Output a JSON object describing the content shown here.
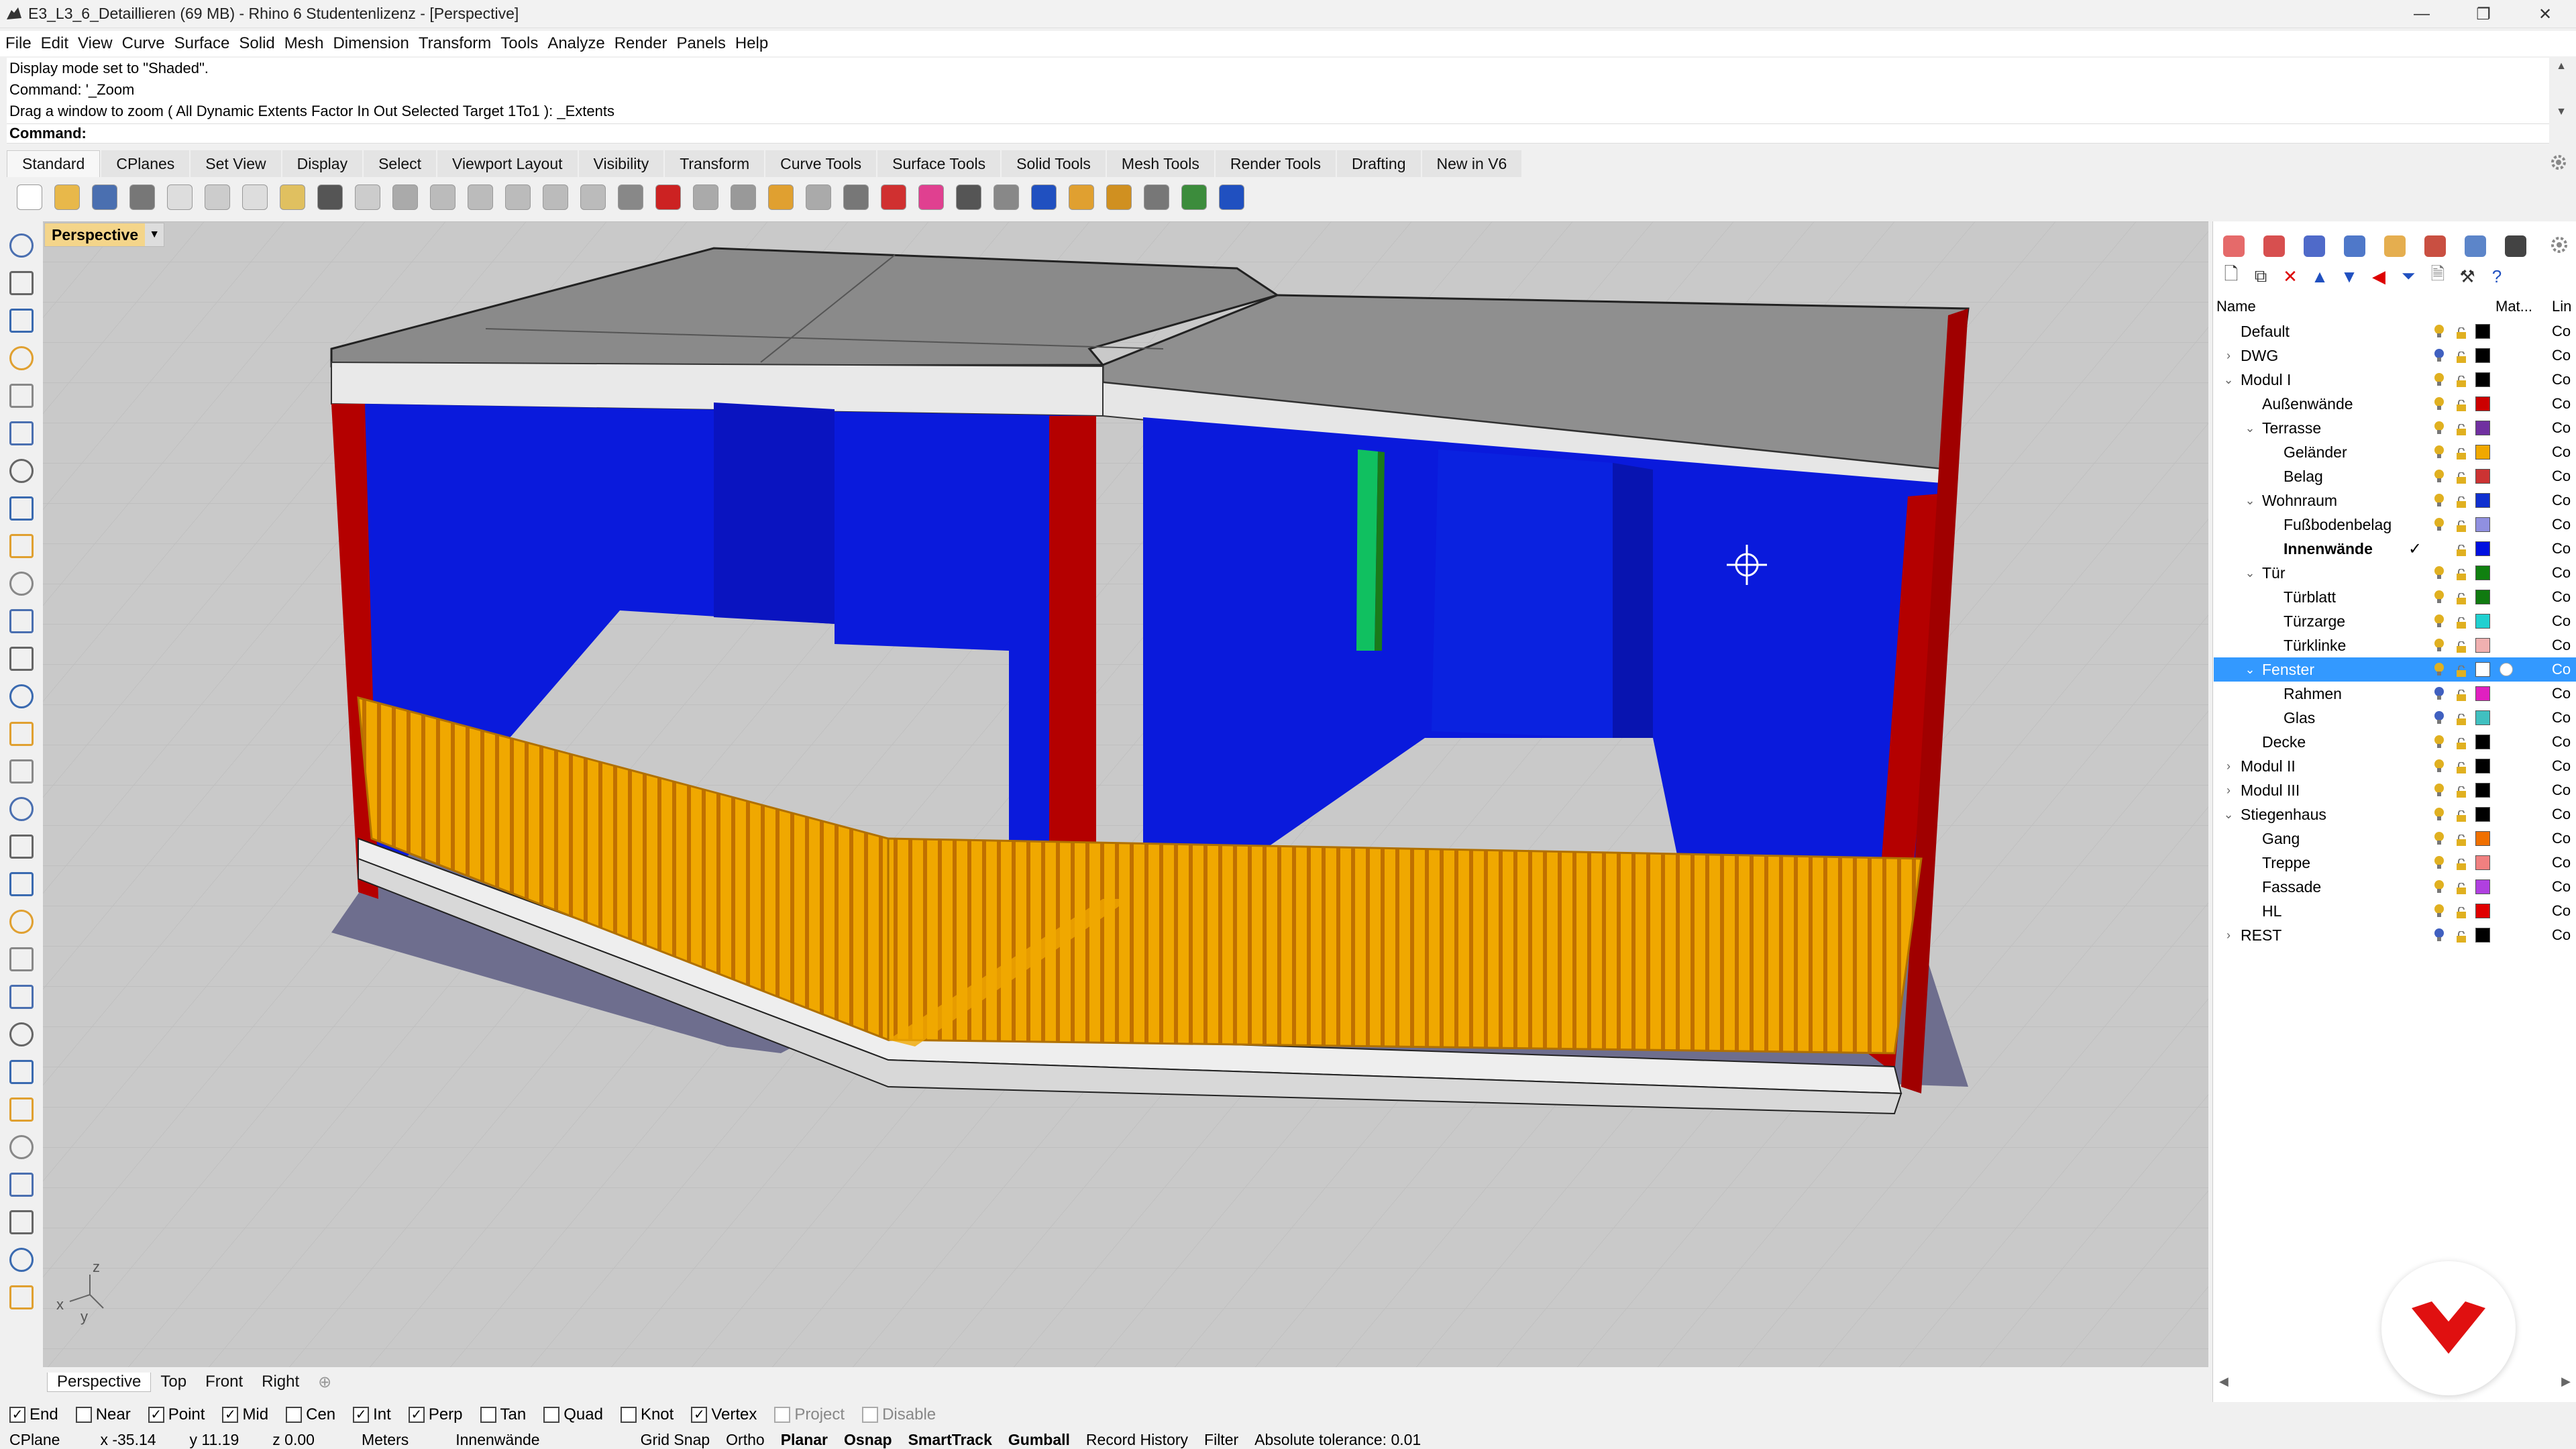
{
  "window": {
    "title": "E3_L3_6_Detaillieren (69 MB) - Rhino 6 Studentenlizenz - [Perspective]",
    "controls": [
      "—",
      "❐",
      "✕"
    ]
  },
  "menu": [
    "File",
    "Edit",
    "View",
    "Curve",
    "Surface",
    "Solid",
    "Mesh",
    "Dimension",
    "Transform",
    "Tools",
    "Analyze",
    "Render",
    "Panels",
    "Help"
  ],
  "command_history": [
    "Display mode set to \"Shaded\".",
    "Command: '_Zoom",
    "Drag a window to zoom ( All  Dynamic  Extents  Factor  In  Out  Selected  Target  1To1 ): _Extents"
  ],
  "command_prompt": {
    "label": "Command:",
    "value": ""
  },
  "toolbar_tabs": [
    "Standard",
    "CPlanes",
    "Set View",
    "Display",
    "Select",
    "Viewport Layout",
    "Visibility",
    "Transform",
    "Curve Tools",
    "Surface Tools",
    "Solid Tools",
    "Mesh Tools",
    "Render Tools",
    "Drafting",
    "New in V6"
  ],
  "active_toolbar_tab": "Standard",
  "standard_tools": [
    {
      "name": "new-file-icon",
      "color": "#ffffff"
    },
    {
      "name": "open-file-icon",
      "color": "#e8b84a"
    },
    {
      "name": "save-icon",
      "color": "#4a6fb0"
    },
    {
      "name": "print-icon",
      "color": "#777777"
    },
    {
      "name": "export-icon",
      "color": "#dddddd"
    },
    {
      "name": "cut-icon",
      "color": "#cccccc"
    },
    {
      "name": "copy-icon",
      "color": "#dddddd"
    },
    {
      "name": "paste-icon",
      "color": "#e0c060"
    },
    {
      "name": "undo-icon",
      "color": "#555555"
    },
    {
      "name": "pan-icon",
      "color": "#cccccc"
    },
    {
      "name": "rotate-view-icon",
      "color": "#aaaaaa"
    },
    {
      "name": "zoom-dynamic-icon",
      "color": "#bbbbbb"
    },
    {
      "name": "zoom-window-icon",
      "color": "#bbbbbb"
    },
    {
      "name": "zoom-extents-icon",
      "color": "#bbbbbb"
    },
    {
      "name": "zoom-selected-icon",
      "color": "#bbbbbb"
    },
    {
      "name": "undo-view-icon",
      "color": "#bbbbbb"
    },
    {
      "name": "four-viewports-icon",
      "color": "#888888"
    },
    {
      "name": "car-icon",
      "color": "#cc2222"
    },
    {
      "name": "grid-plane-icon",
      "color": "#aaaaaa"
    },
    {
      "name": "cplane-icon",
      "color": "#999999"
    },
    {
      "name": "select-icon",
      "color": "#e0a030"
    },
    {
      "name": "light-bulb-icon",
      "color": "#aaaaaa"
    },
    {
      "name": "lock-icon",
      "color": "#777777"
    },
    {
      "name": "material-icon",
      "color": "#d03030"
    },
    {
      "name": "color-wheel-icon",
      "color": "#e04090"
    },
    {
      "name": "shaded-sphere-icon",
      "color": "#555555"
    },
    {
      "name": "rendered-sphere-icon",
      "color": "#888888"
    },
    {
      "name": "render-icon",
      "color": "#2050c0"
    },
    {
      "name": "analysis-icon",
      "color": "#e0a030"
    },
    {
      "name": "options-gear-icon",
      "color": "#d09020"
    },
    {
      "name": "dimension-icon",
      "color": "#777777"
    },
    {
      "name": "web-icon",
      "color": "#3c8c3c"
    },
    {
      "name": "help-icon",
      "color": "#2050c0"
    }
  ],
  "left_tools": [
    "select-arrow-icon",
    "point-icon",
    "polyline-icon",
    "curve-icon",
    "circle-icon",
    "arc-icon",
    "ellipse-icon",
    "polygon-icon",
    "rectangle-icon",
    "freeform-icon",
    "circle-center-icon",
    "fillet-curve-icon",
    "surface-icon",
    "extrude-icon",
    "box-icon",
    "sphere-icon",
    "cylinder-icon",
    "mesh-icon",
    "boolean-icon",
    "analyze-icon",
    "dimension-tool-icon",
    "transform-icon",
    "array-icon",
    "blend-icon",
    "text-icon",
    "move-icon",
    "scale-icon",
    "edit-points-icon",
    "solid-edit-icon"
  ],
  "viewport": {
    "name": "Perspective",
    "axes": {
      "x": "x",
      "y": "y",
      "z": "z"
    }
  },
  "viewport_tabs": [
    "Perspective",
    "Top",
    "Front",
    "Right"
  ],
  "osnaps": [
    {
      "label": "End",
      "checked": true,
      "disabled": false
    },
    {
      "label": "Near",
      "checked": false,
      "disabled": false
    },
    {
      "label": "Point",
      "checked": true,
      "disabled": false
    },
    {
      "label": "Mid",
      "checked": true,
      "disabled": false
    },
    {
      "label": "Cen",
      "checked": false,
      "disabled": false
    },
    {
      "label": "Int",
      "checked": true,
      "disabled": false
    },
    {
      "label": "Perp",
      "checked": true,
      "disabled": false
    },
    {
      "label": "Tan",
      "checked": false,
      "disabled": false
    },
    {
      "label": "Quad",
      "checked": false,
      "disabled": false
    },
    {
      "label": "Knot",
      "checked": false,
      "disabled": false
    },
    {
      "label": "Vertex",
      "checked": true,
      "disabled": false
    },
    {
      "label": "Project",
      "checked": false,
      "disabled": true
    },
    {
      "label": "Disable",
      "checked": false,
      "disabled": true
    }
  ],
  "status": {
    "cplane": "CPlane",
    "x": "x -35.14",
    "y": "y 11.19",
    "z": "z 0.00",
    "units": "Meters",
    "layer": "Innenwände",
    "grid_snap": "Grid Snap",
    "ortho": "Ortho",
    "planar": "Planar",
    "osnap": "Osnap",
    "smarttrack": "SmartTrack",
    "gumball": "Gumball",
    "record_history": "Record History",
    "filter": "Filter",
    "tolerance": "Absolute tolerance: 0.01"
  },
  "panel_tabs": [
    {
      "name": "properties-icon",
      "color": "#e05050"
    },
    {
      "name": "layers-icon",
      "color": "#d03030"
    },
    {
      "name": "render-panel-icon",
      "color": "#3050c0"
    },
    {
      "name": "materials-panel-icon",
      "color": "#3060c0"
    },
    {
      "name": "libraries-icon",
      "color": "#e0a030"
    },
    {
      "name": "environment-icon",
      "color": "#c03020"
    },
    {
      "name": "display-panel-icon",
      "color": "#4070c0"
    },
    {
      "name": "camera-icon",
      "color": "#222222"
    }
  ],
  "layer_tools": [
    {
      "name": "new-layer-icon",
      "glyph": "🗋"
    },
    {
      "name": "new-sublayer-icon",
      "glyph": "⧉"
    },
    {
      "name": "delete-layer-icon",
      "glyph": "✕"
    },
    {
      "name": "move-up-icon",
      "glyph": "▲"
    },
    {
      "name": "move-down-icon",
      "glyph": "▼"
    },
    {
      "name": "move-parent-icon",
      "glyph": "◀"
    },
    {
      "name": "filter-icon",
      "glyph": "⏷"
    },
    {
      "name": "layer-state-icon",
      "glyph": "🗎"
    },
    {
      "name": "tools-icon",
      "glyph": "⚒"
    },
    {
      "name": "help-layer-icon",
      "glyph": "?"
    }
  ],
  "layer_header": {
    "name": "Name",
    "material": "Mat...",
    "linetype": "Lin"
  },
  "layers": [
    {
      "name": "Default",
      "level": 0,
      "expand": "",
      "color": "#000000",
      "bulb": "#e0b020"
    },
    {
      "name": "DWG",
      "level": 0,
      "expand": "›",
      "color": "#000000",
      "bulb": "#4060c0"
    },
    {
      "name": "Modul I",
      "level": 0,
      "expand": "⌄",
      "color": "#000000",
      "bulb": "#e0b020"
    },
    {
      "name": "Außenwände",
      "level": 1,
      "expand": "",
      "color": "#cc0000",
      "bulb": "#e0b020"
    },
    {
      "name": "Terrasse",
      "level": 1,
      "expand": "⌄",
      "color": "#7030a0",
      "bulb": "#e0b020"
    },
    {
      "name": "Geländer",
      "level": 2,
      "expand": "",
      "color": "#f0a800",
      "bulb": "#e0b020"
    },
    {
      "name": "Belag",
      "level": 2,
      "expand": "",
      "color": "#cc3333",
      "bulb": "#e0b020"
    },
    {
      "name": "Wohnraum",
      "level": 1,
      "expand": "⌄",
      "color": "#1030d0",
      "bulb": "#e0b020"
    },
    {
      "name": "Fußbodenbelag",
      "level": 2,
      "expand": "",
      "color": "#9090e0",
      "bulb": "#e0b020"
    },
    {
      "name": "Innenwände",
      "level": 2,
      "expand": "",
      "color": "#0010e0",
      "bulb": "",
      "current": true
    },
    {
      "name": "Tür",
      "level": 1,
      "expand": "⌄",
      "color": "#108010",
      "bulb": "#e0b020"
    },
    {
      "name": "Türblatt",
      "level": 2,
      "expand": "",
      "color": "#107a10",
      "bulb": "#e0b020"
    },
    {
      "name": "Türzarge",
      "level": 2,
      "expand": "",
      "color": "#20d0d0",
      "bulb": "#e0b020"
    },
    {
      "name": "Türklinke",
      "level": 2,
      "expand": "",
      "color": "#f0b0b0",
      "bulb": "#e0b020"
    },
    {
      "name": "Fenster",
      "level": 1,
      "expand": "⌄",
      "color": "#ffffff",
      "bulb": "#e0b020",
      "selected": true
    },
    {
      "name": "Rahmen",
      "level": 2,
      "expand": "",
      "color": "#e020c0",
      "bulb": "#4060c0"
    },
    {
      "name": "Glas",
      "level": 2,
      "expand": "",
      "color": "#40c0c0",
      "bulb": "#4060c0"
    },
    {
      "name": "Decke",
      "level": 1,
      "expand": "",
      "color": "#000000",
      "bulb": "#e0b020"
    },
    {
      "name": "Modul II",
      "level": 0,
      "expand": "›",
      "color": "#000000",
      "bulb": "#e0b020"
    },
    {
      "name": "Modul III",
      "level": 0,
      "expand": "›",
      "color": "#000000",
      "bulb": "#e0b020"
    },
    {
      "name": "Stiegenhaus",
      "level": 0,
      "expand": "⌄",
      "color": "#000000",
      "bulb": "#e0b020"
    },
    {
      "name": "Gang",
      "level": 1,
      "expand": "",
      "color": "#f07000",
      "bulb": "#e0b020"
    },
    {
      "name": "Treppe",
      "level": 1,
      "expand": "",
      "color": "#f08080",
      "bulb": "#e0b020"
    },
    {
      "name": "Fassade",
      "level": 1,
      "expand": "",
      "color": "#b040e0",
      "bulb": "#e0b020"
    },
    {
      "name": "HL",
      "level": 1,
      "expand": "",
      "color": "#e00000",
      "bulb": "#e0b020"
    },
    {
      "name": "REST",
      "level": 0,
      "expand": "›",
      "color": "#000000",
      "bulb": "#4060c0"
    }
  ],
  "layer_linetype": "Co",
  "colors": {
    "accent": "#3399ff",
    "roof": "#8c8c8c",
    "inner_walls": "#0a1adc",
    "outer_walls": "#b40000",
    "railing": "#f0a800",
    "floor": "#6e6e8e",
    "background": "#c8c8c8",
    "logo": "#e01010"
  }
}
